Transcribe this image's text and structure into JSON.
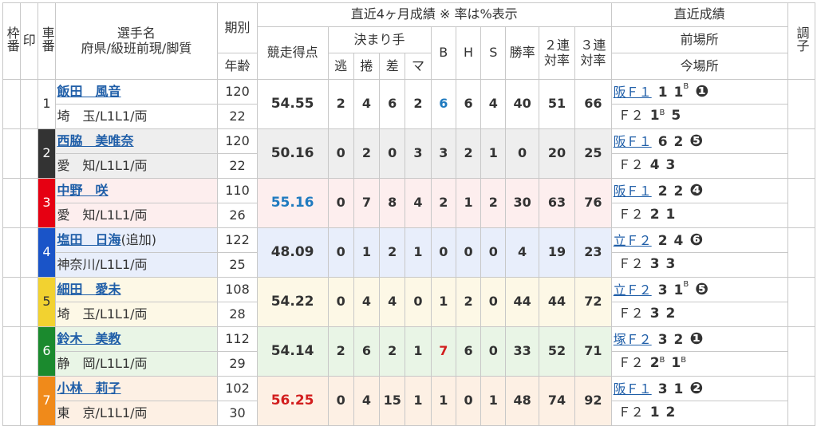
{
  "header": {
    "waku": "枠番",
    "shirushi": "印",
    "sha": "車番",
    "name": "選手名",
    "name_sub": "府県/級班前現/脚質",
    "period": "期別",
    "age": "年齢",
    "stats_title": "直近4ヶ月成績 ※ 率は%表示",
    "score": "競走得点",
    "kimarite": "決まり手",
    "nige": "逃",
    "makuri": "捲",
    "sashi": "差",
    "mark": "マ",
    "b": "B",
    "h": "H",
    "s": "S",
    "win": "勝率",
    "rentai2": "２連対率",
    "rentai3": "３連対率",
    "recent_title": "直近成績",
    "prev_venue": "前場所",
    "curr_venue": "今場所",
    "condition": "調子"
  },
  "racers": [
    {
      "car": "1",
      "name": "飯田　風音",
      "addition": "",
      "pref": "埼　玉/L1L1/両",
      "period": "120",
      "age": "22",
      "score": "54.55",
      "score_color": "normal",
      "nige": "2",
      "makuri": "4",
      "sashi": "6",
      "mark": "2",
      "b": "6",
      "b_color": "blue",
      "h": "6",
      "s": "4",
      "win": "40",
      "r2": "51",
      "r3": "66",
      "prev_place": "阪Ｆ１",
      "prev_r1": "1",
      "prev_r1_sup": "",
      "prev_r2": "1",
      "prev_r2_sup": "B",
      "prev_r3": "❶",
      "curr_place": "Ｆ２",
      "curr_r1": "1",
      "curr_r1_sup": "B",
      "curr_r2": "5",
      "curr_r2_sup": ""
    },
    {
      "car": "2",
      "name": "西脇　美唯奈",
      "addition": "",
      "pref": "愛　知/L1L1/両",
      "period": "120",
      "age": "22",
      "score": "50.16",
      "score_color": "normal",
      "nige": "0",
      "makuri": "2",
      "sashi": "0",
      "mark": "3",
      "b": "3",
      "b_color": "normal",
      "h": "2",
      "s": "1",
      "win": "0",
      "r2": "20",
      "r3": "25",
      "prev_place": "阪Ｆ１",
      "prev_r1": "6",
      "prev_r1_sup": "",
      "prev_r2": "2",
      "prev_r2_sup": "",
      "prev_r3": "❺",
      "curr_place": "Ｆ２",
      "curr_r1": "4",
      "curr_r1_sup": "",
      "curr_r2": "3",
      "curr_r2_sup": ""
    },
    {
      "car": "3",
      "name": "中野　咲",
      "addition": "",
      "pref": "愛　知/L1L1/両",
      "period": "110",
      "age": "26",
      "score": "55.16",
      "score_color": "blue",
      "nige": "0",
      "makuri": "7",
      "sashi": "8",
      "mark": "4",
      "b": "2",
      "b_color": "normal",
      "h": "1",
      "s": "2",
      "win": "30",
      "r2": "63",
      "r3": "76",
      "prev_place": "阪Ｆ１",
      "prev_r1": "2",
      "prev_r1_sup": "",
      "prev_r2": "2",
      "prev_r2_sup": "",
      "prev_r3": "❹",
      "curr_place": "Ｆ２",
      "curr_r1": "2",
      "curr_r1_sup": "",
      "curr_r2": "1",
      "curr_r2_sup": ""
    },
    {
      "car": "4",
      "name": "塩田　日海",
      "addition": "(追加)",
      "pref": "神奈川/L1L1/両",
      "period": "122",
      "age": "25",
      "score": "48.09",
      "score_color": "normal",
      "nige": "0",
      "makuri": "1",
      "sashi": "2",
      "mark": "1",
      "b": "0",
      "b_color": "normal",
      "h": "0",
      "s": "0",
      "win": "4",
      "r2": "19",
      "r3": "23",
      "prev_place": "立Ｆ２",
      "prev_r1": "2",
      "prev_r1_sup": "",
      "prev_r2": "4",
      "prev_r2_sup": "",
      "prev_r3": "❻",
      "curr_place": "Ｆ２",
      "curr_r1": "3",
      "curr_r1_sup": "",
      "curr_r2": "3",
      "curr_r2_sup": ""
    },
    {
      "car": "5",
      "name": "細田　愛未",
      "addition": "",
      "pref": "埼　玉/L1L1/両",
      "period": "108",
      "age": "28",
      "score": "54.22",
      "score_color": "normal",
      "nige": "0",
      "makuri": "4",
      "sashi": "4",
      "mark": "0",
      "b": "1",
      "b_color": "normal",
      "h": "2",
      "s": "0",
      "win": "44",
      "r2": "44",
      "r3": "72",
      "prev_place": "立Ｆ２",
      "prev_r1": "3",
      "prev_r1_sup": "",
      "prev_r2": "1",
      "prev_r2_sup": "B",
      "prev_r3": "❺",
      "curr_place": "Ｆ２",
      "curr_r1": "3",
      "curr_r1_sup": "",
      "curr_r2": "2",
      "curr_r2_sup": ""
    },
    {
      "car": "6",
      "name": "鈴木　美教",
      "addition": "",
      "pref": "静　岡/L1L1/両",
      "period": "112",
      "age": "29",
      "score": "54.14",
      "score_color": "normal",
      "nige": "2",
      "makuri": "6",
      "sashi": "2",
      "mark": "1",
      "b": "7",
      "b_color": "red",
      "h": "6",
      "s": "0",
      "win": "33",
      "r2": "52",
      "r3": "71",
      "prev_place": "塚Ｆ２",
      "prev_r1": "3",
      "prev_r1_sup": "",
      "prev_r2": "2",
      "prev_r2_sup": "",
      "prev_r3": "❶",
      "curr_place": "Ｆ２",
      "curr_r1": "2",
      "curr_r1_sup": "B",
      "curr_r2": "1",
      "curr_r2_sup": "B"
    },
    {
      "car": "7",
      "name": "小林　莉子",
      "addition": "",
      "pref": "東　京/L1L1/両",
      "period": "102",
      "age": "30",
      "score": "56.25",
      "score_color": "red",
      "nige": "0",
      "makuri": "4",
      "sashi": "15",
      "mark": "1",
      "b": "1",
      "b_color": "normal",
      "h": "0",
      "s": "1",
      "win": "48",
      "r2": "74",
      "r3": "92",
      "prev_place": "阪Ｆ１",
      "prev_r1": "3",
      "prev_r1_sup": "",
      "prev_r2": "1",
      "prev_r2_sup": "",
      "prev_r3": "❷",
      "curr_place": "Ｆ２",
      "curr_r1": "1",
      "curr_r1_sup": "",
      "curr_r2": "2",
      "curr_r2_sup": ""
    }
  ]
}
